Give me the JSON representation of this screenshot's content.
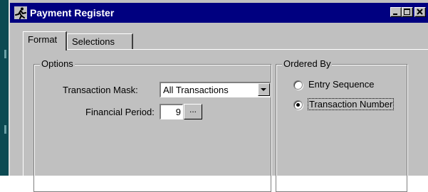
{
  "window": {
    "title": "Payment Register",
    "icon": "running-man-icon",
    "controls": [
      "minimize",
      "maximize",
      "close"
    ],
    "titlebar_color": "#000080"
  },
  "tabs": [
    {
      "label": "Format",
      "active": true
    },
    {
      "label": "Selections",
      "active": false
    }
  ],
  "options": {
    "legend": "Options",
    "transaction_mask_label": "Transaction Mask:",
    "transaction_mask_value": "All Transactions",
    "financial_period_label": "Financial Period:",
    "financial_period_value": "9",
    "lookup_label": "..."
  },
  "ordered_by": {
    "legend": "Ordered By",
    "items": [
      {
        "label": "Entry Sequence",
        "selected": false
      },
      {
        "label": "Transaction Number",
        "selected": true
      }
    ]
  }
}
